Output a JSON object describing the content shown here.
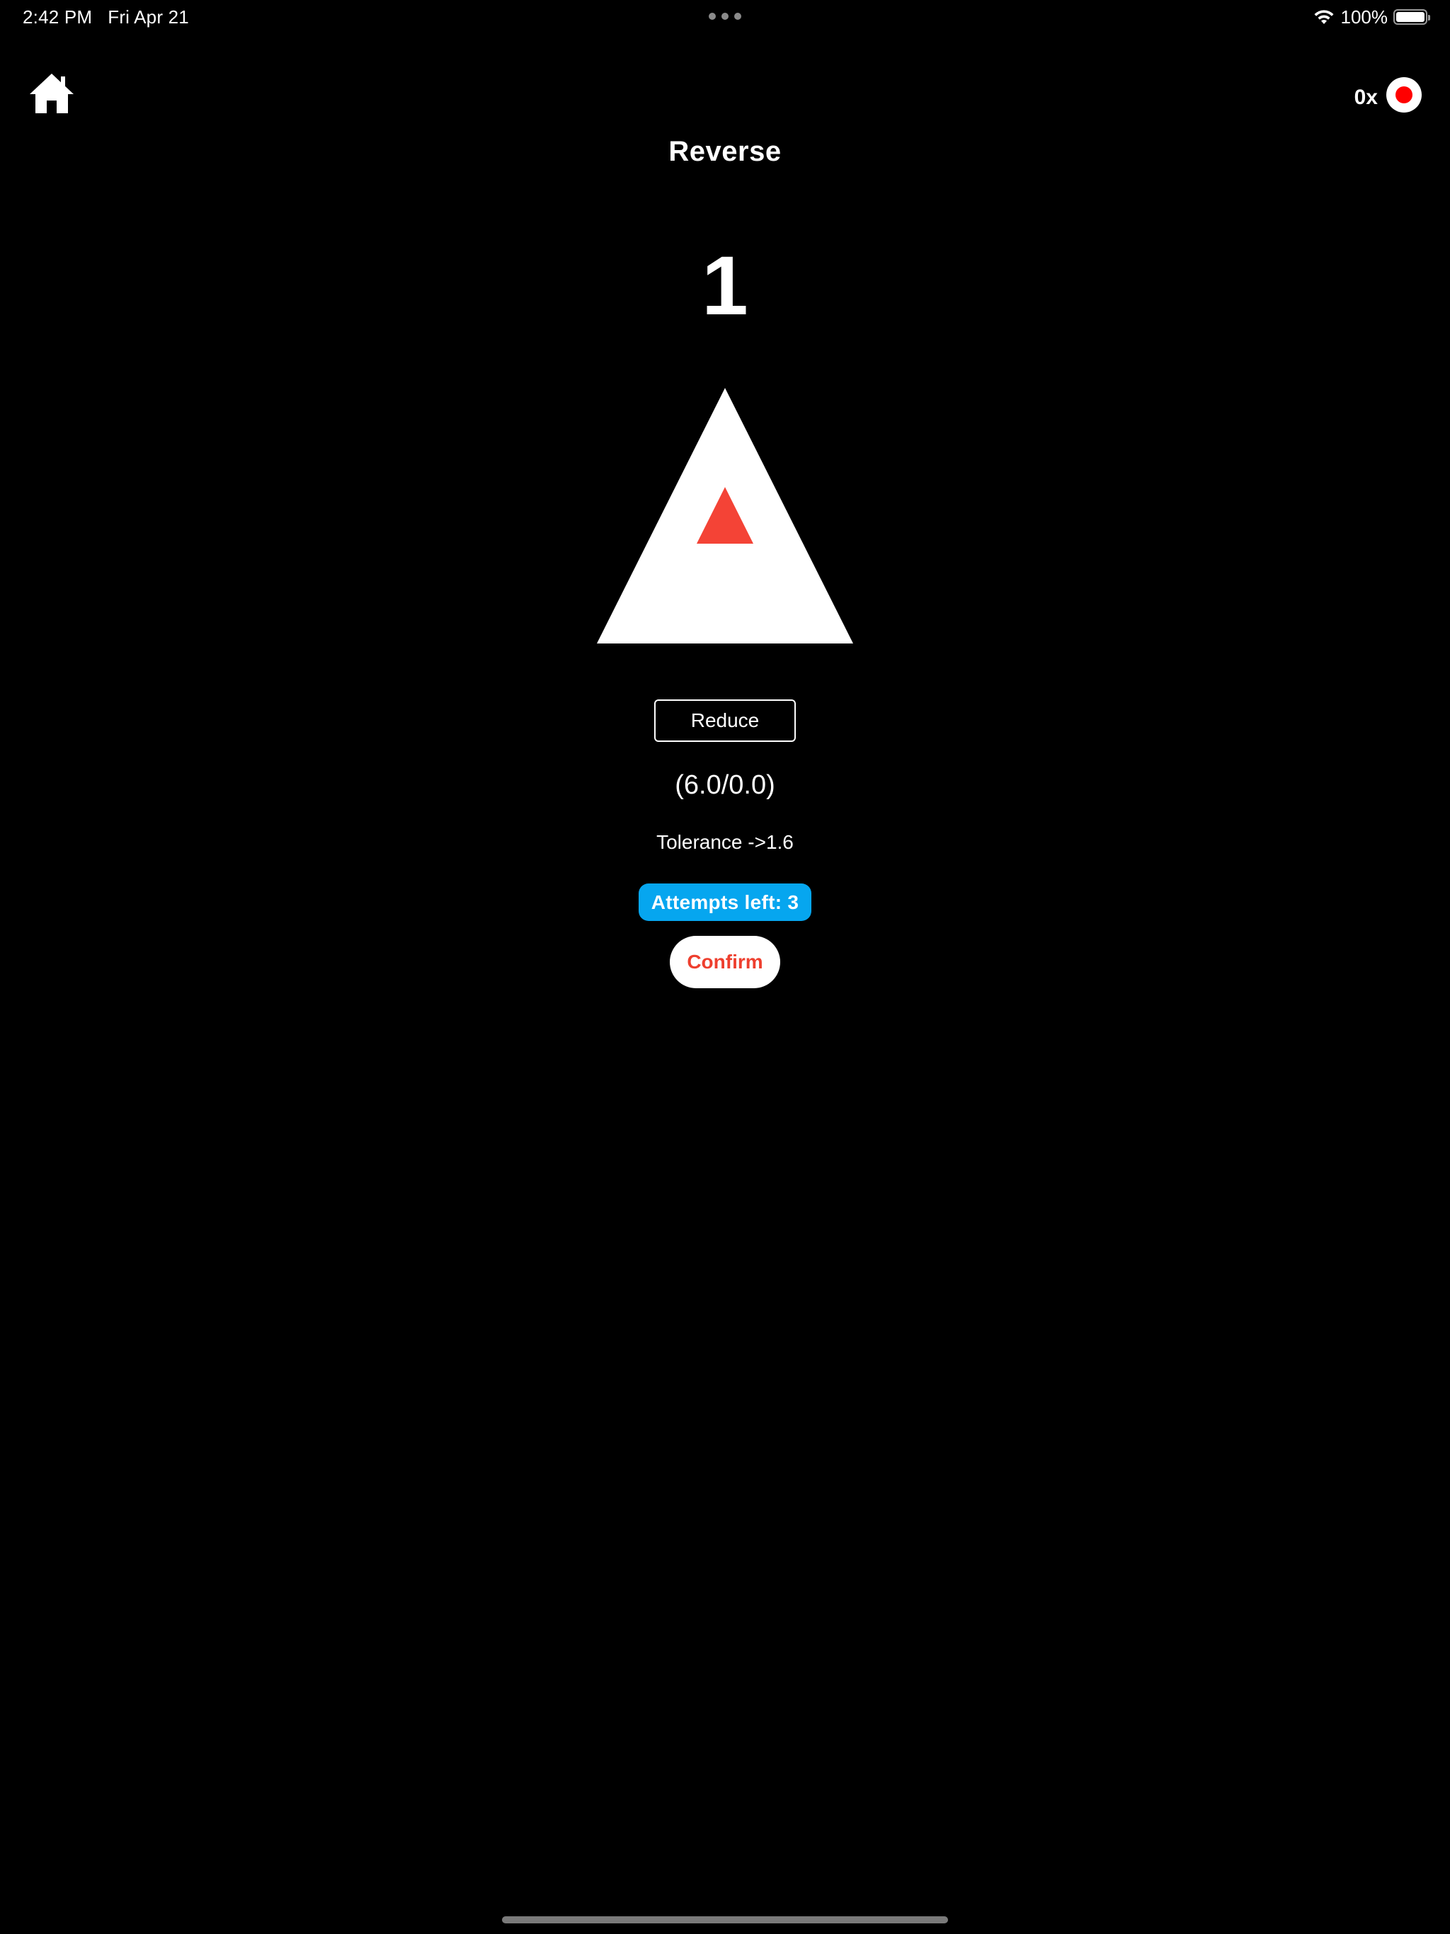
{
  "status_bar": {
    "time": "2:42 PM",
    "date": "Fri Apr 21",
    "battery_percent": "100%",
    "battery_level": 1.0,
    "icons": [
      "wifi-icon",
      "battery-icon",
      "multitasking-dots-icon"
    ]
  },
  "nav": {
    "home_icon": "home-icon",
    "counter": "0x",
    "record_icon": "record-icon"
  },
  "title": "Reverse",
  "level_number": "1",
  "shape": {
    "outer": "white-triangle",
    "inner": "red-triangle"
  },
  "controls": {
    "reduce_label": "Reduce",
    "coords": "(6.0/0.0)",
    "tolerance": "Tolerance ->1.6",
    "attempts": "Attempts left: 3",
    "confirm_label": "Confirm"
  },
  "colors": {
    "background": "#000000",
    "accent_blue": "#06a6ef",
    "accent_red": "#ee3f2e",
    "record_red": "#ff0000",
    "white": "#ffffff"
  }
}
